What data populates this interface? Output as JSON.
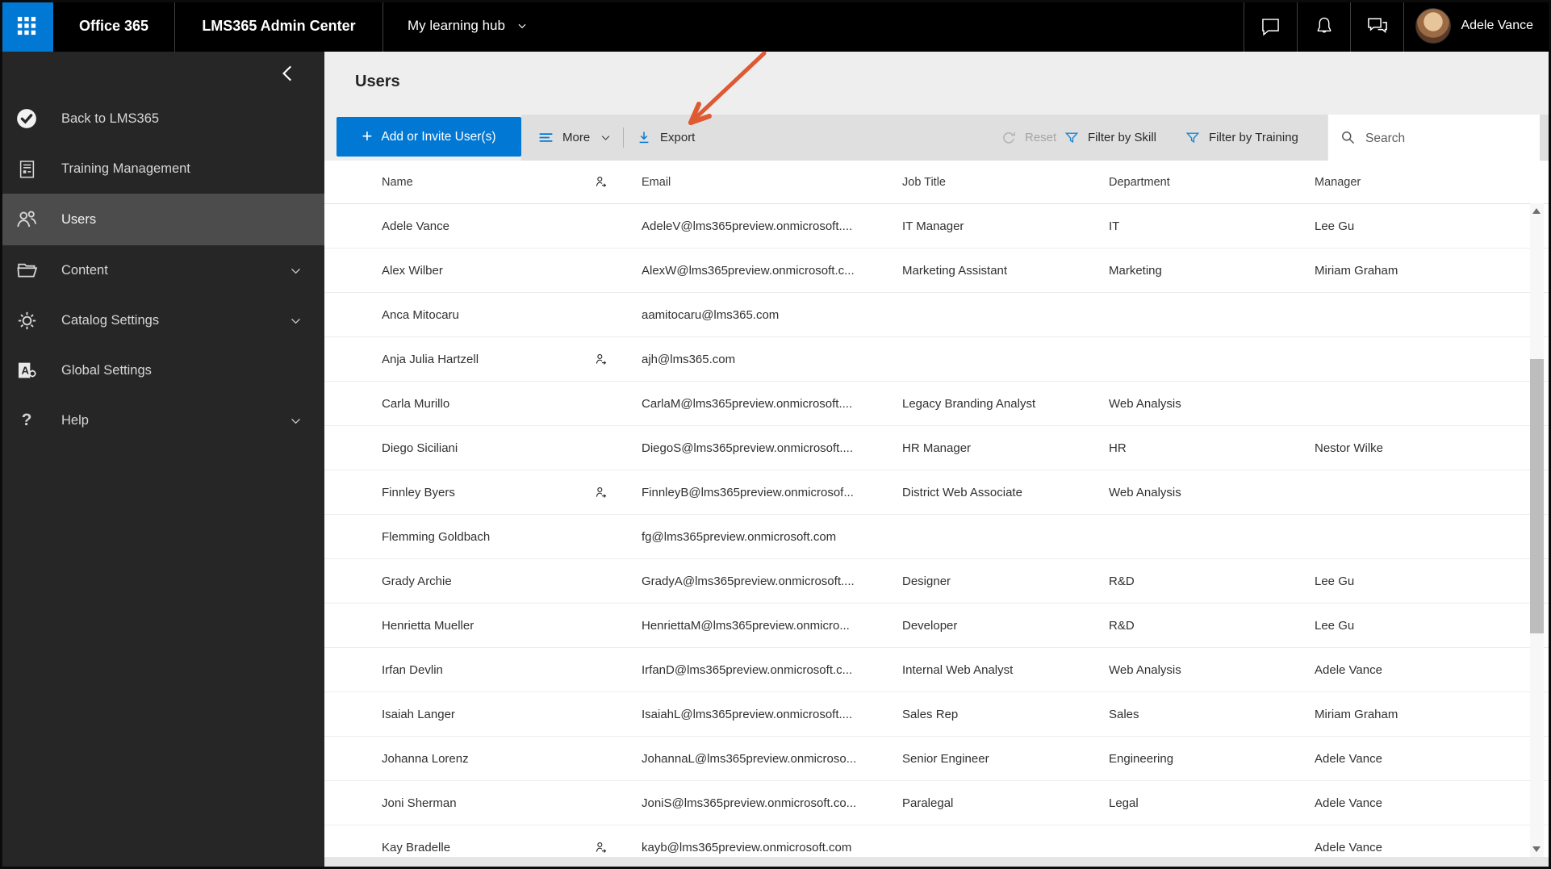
{
  "topbar": {
    "product": "Office 365",
    "admin_center": "LMS365 Admin Center",
    "hub_menu": "My learning hub",
    "user_name": "Adele Vance"
  },
  "sidebar": {
    "items": [
      {
        "label": "Back to LMS365",
        "icon": "lms365",
        "selected": false,
        "chevron": false
      },
      {
        "label": "Training Management",
        "icon": "training",
        "selected": false,
        "chevron": false
      },
      {
        "label": "Users",
        "icon": "users",
        "selected": true,
        "chevron": false
      },
      {
        "label": "Content",
        "icon": "folder",
        "selected": false,
        "chevron": true
      },
      {
        "label": "Catalog Settings",
        "icon": "gear",
        "selected": false,
        "chevron": true
      },
      {
        "label": "Global Settings",
        "icon": "global",
        "selected": false,
        "chevron": false
      },
      {
        "label": "Help",
        "icon": "help",
        "selected": false,
        "chevron": true
      }
    ]
  },
  "main": {
    "title": "Users",
    "toolbar": {
      "add_label": "Add or Invite User(s)",
      "more_label": "More",
      "export_label": "Export",
      "reset_label": "Reset",
      "filter_skill_label": "Filter by Skill",
      "filter_training_label": "Filter by Training",
      "search_placeholder": "Search"
    },
    "table": {
      "columns": [
        "Name",
        "Email",
        "Job Title",
        "Department",
        "Manager"
      ],
      "rows": [
        {
          "name": "Adele Vance",
          "external": false,
          "email": "AdeleV@lms365preview.onmicrosoft....",
          "job_title": "IT Manager",
          "department": "IT",
          "manager": "Lee Gu"
        },
        {
          "name": "Alex Wilber",
          "external": false,
          "email": "AlexW@lms365preview.onmicrosoft.c...",
          "job_title": "Marketing Assistant",
          "department": "Marketing",
          "manager": "Miriam Graham"
        },
        {
          "name": "Anca Mitocaru",
          "external": false,
          "email": "aamitocaru@lms365.com",
          "job_title": "",
          "department": "",
          "manager": ""
        },
        {
          "name": "Anja Julia Hartzell",
          "external": true,
          "email": "ajh@lms365.com",
          "job_title": "",
          "department": "",
          "manager": ""
        },
        {
          "name": "Carla Murillo",
          "external": false,
          "email": "CarlaM@lms365preview.onmicrosoft....",
          "job_title": "Legacy Branding Analyst",
          "department": "Web Analysis",
          "manager": ""
        },
        {
          "name": "Diego Siciliani",
          "external": false,
          "email": "DiegoS@lms365preview.onmicrosoft....",
          "job_title": "HR Manager",
          "department": "HR",
          "manager": "Nestor Wilke"
        },
        {
          "name": "Finnley Byers",
          "external": true,
          "email": "FinnleyB@lms365preview.onmicrosof...",
          "job_title": "District Web Associate",
          "department": "Web Analysis",
          "manager": ""
        },
        {
          "name": "Flemming Goldbach",
          "external": false,
          "email": "fg@lms365preview.onmicrosoft.com",
          "job_title": "",
          "department": "",
          "manager": ""
        },
        {
          "name": "Grady Archie",
          "external": false,
          "email": "GradyA@lms365preview.onmicrosoft....",
          "job_title": "Designer",
          "department": "R&D",
          "manager": "Lee Gu"
        },
        {
          "name": "Henrietta Mueller",
          "external": false,
          "email": "HenriettaM@lms365preview.onmicro...",
          "job_title": "Developer",
          "department": "R&D",
          "manager": "Lee Gu"
        },
        {
          "name": "Irfan Devlin",
          "external": false,
          "email": "IrfanD@lms365preview.onmicrosoft.c...",
          "job_title": "Internal Web Analyst",
          "department": "Web Analysis",
          "manager": "Adele Vance"
        },
        {
          "name": "Isaiah Langer",
          "external": false,
          "email": "IsaiahL@lms365preview.onmicrosoft....",
          "job_title": "Sales Rep",
          "department": "Sales",
          "manager": "Miriam Graham"
        },
        {
          "name": "Johanna Lorenz",
          "external": false,
          "email": "JohannaL@lms365preview.onmicroso...",
          "job_title": "Senior Engineer",
          "department": "Engineering",
          "manager": "Adele Vance"
        },
        {
          "name": "Joni Sherman",
          "external": false,
          "email": "JoniS@lms365preview.onmicrosoft.co...",
          "job_title": "Paralegal",
          "department": "Legal",
          "manager": "Adele Vance"
        },
        {
          "name": "Kay Bradelle",
          "external": true,
          "email": "kayb@lms365preview.onmicrosoft.com",
          "job_title": "",
          "department": "",
          "manager": "Adele Vance"
        }
      ]
    }
  },
  "annotation": {
    "type": "arrow",
    "color": "#dd5a32",
    "points_at": "Export"
  },
  "colors": {
    "accent": "#0078d4",
    "topbar": "#000000",
    "sidebar": "#262626",
    "sidebar_selected": "#4c4c4c"
  }
}
